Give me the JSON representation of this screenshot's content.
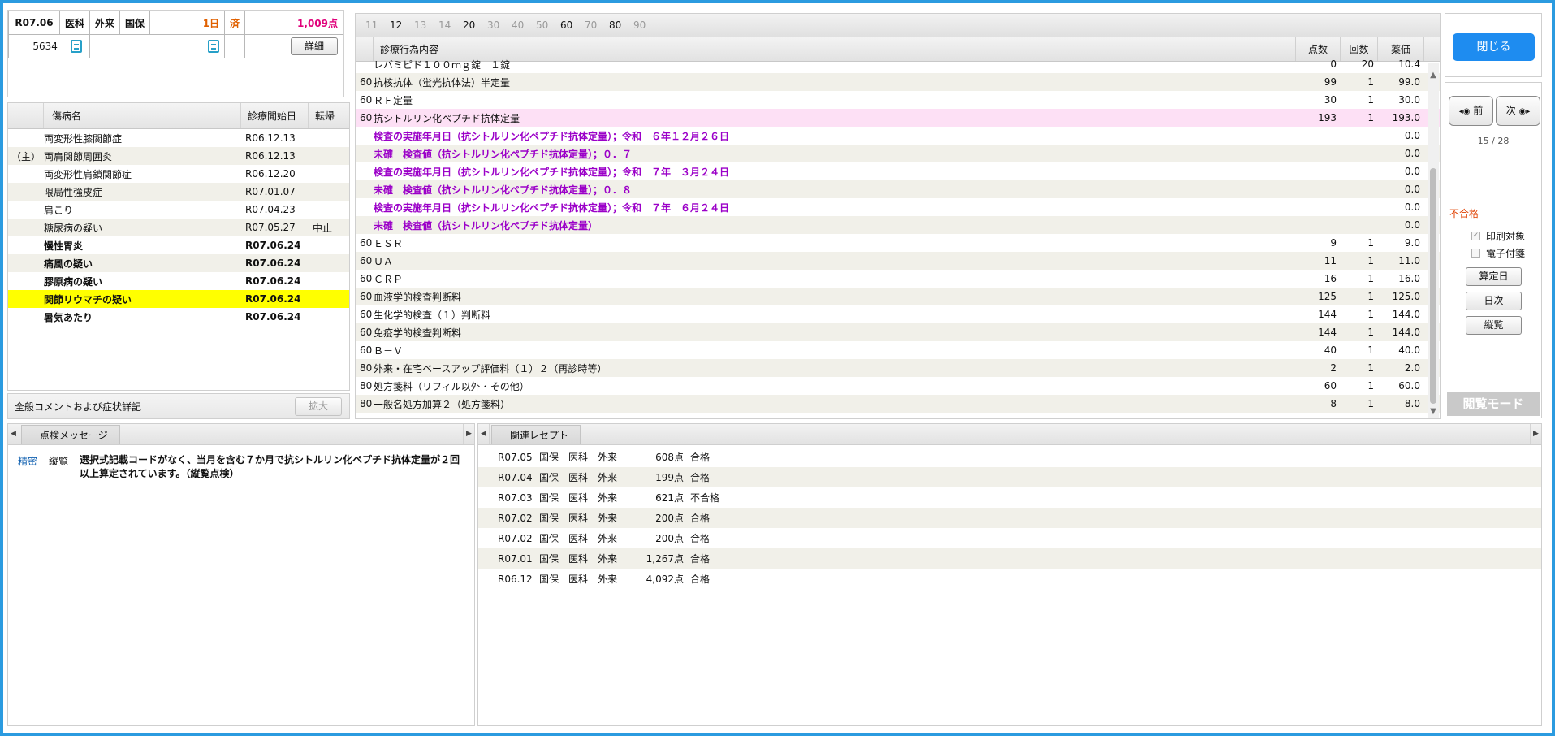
{
  "header": {
    "month": "R07.06",
    "dept": "医科",
    "visit_type": "外来",
    "insurance": "国保",
    "days": "1日",
    "status": "済",
    "total_points": "1,009点",
    "patient_no": "5634",
    "detail_label": "詳細"
  },
  "disease": {
    "headers": [
      "",
      "傷病名",
      "診療開始日",
      "転帰"
    ],
    "rows": [
      {
        "mark": "",
        "name": "両変形性膝関節症",
        "date": "R06.12.13",
        "outcome": "",
        "bold": false,
        "highlight": false
      },
      {
        "mark": "（主）",
        "name": "両肩関節周囲炎",
        "date": "R06.12.13",
        "outcome": "",
        "bold": false,
        "highlight": false
      },
      {
        "mark": "",
        "name": "両変形性肩鎖関節症",
        "date": "R06.12.20",
        "outcome": "",
        "bold": false,
        "highlight": false
      },
      {
        "mark": "",
        "name": "限局性強皮症",
        "date": "R07.01.07",
        "outcome": "",
        "bold": false,
        "highlight": false
      },
      {
        "mark": "",
        "name": "肩こり",
        "date": "R07.04.23",
        "outcome": "",
        "bold": false,
        "highlight": false
      },
      {
        "mark": "",
        "name": "糖尿病の疑い",
        "date": "R07.05.27",
        "outcome": "中止",
        "bold": false,
        "highlight": false
      },
      {
        "mark": "",
        "name": "慢性胃炎",
        "date": "R07.06.24",
        "outcome": "",
        "bold": true,
        "highlight": false
      },
      {
        "mark": "",
        "name": "痛風の疑い",
        "date": "R07.06.24",
        "outcome": "",
        "bold": true,
        "highlight": false
      },
      {
        "mark": "",
        "name": "膠原病の疑い",
        "date": "R07.06.24",
        "outcome": "",
        "bold": true,
        "highlight": false
      },
      {
        "mark": "",
        "name": "関節リウマチの疑い",
        "date": "R07.06.24",
        "outcome": "",
        "bold": true,
        "highlight": true
      },
      {
        "mark": "",
        "name": "暑気あたり",
        "date": "R07.06.24",
        "outcome": "",
        "bold": true,
        "highlight": false
      }
    ]
  },
  "comment": {
    "label": "全般コメントおよび症状詳記",
    "expand_label": "拡大"
  },
  "treatment": {
    "tabs": [
      {
        "label": "11",
        "on": false
      },
      {
        "label": "12",
        "on": true
      },
      {
        "label": "13",
        "on": false
      },
      {
        "label": "14",
        "on": false
      },
      {
        "label": "20",
        "on": true
      },
      {
        "label": "30",
        "on": false
      },
      {
        "label": "40",
        "on": false
      },
      {
        "label": "50",
        "on": false
      },
      {
        "label": "60",
        "on": true
      },
      {
        "label": "70",
        "on": false
      },
      {
        "label": "80",
        "on": true
      },
      {
        "label": "90",
        "on": false
      }
    ],
    "headers": {
      "name": "診療行為内容",
      "points": "点数",
      "count": "回数",
      "price": "薬価"
    },
    "rows": [
      {
        "cat": "",
        "name": "レバミピド１００ｍｇ錠　１錠",
        "points": "0",
        "count": "20",
        "price": "10.4",
        "sub": false,
        "pink": false
      },
      {
        "cat": "60",
        "name": "抗核抗体（蛍光抗体法）半定量",
        "points": "99",
        "count": "1",
        "price": "99.0",
        "sub": false,
        "pink": false
      },
      {
        "cat": "60",
        "name": "ＲＦ定量",
        "points": "30",
        "count": "1",
        "price": "30.0",
        "sub": false,
        "pink": false
      },
      {
        "cat": "60",
        "name": "抗シトルリン化ペプチド抗体定量",
        "points": "193",
        "count": "1",
        "price": "193.0",
        "sub": false,
        "pink": true
      },
      {
        "cat": "",
        "name": "検査の実施年月日（抗シトルリン化ペプチド抗体定量）；令和　６年１２月２６日",
        "points": "",
        "count": "",
        "price": "0.0",
        "sub": true,
        "pink": false
      },
      {
        "cat": "",
        "name": "未確　検査値（抗シトルリン化ペプチド抗体定量）；０．７",
        "points": "",
        "count": "",
        "price": "0.0",
        "sub": true,
        "pink": false
      },
      {
        "cat": "",
        "name": "検査の実施年月日（抗シトルリン化ペプチド抗体定量）；令和　７年　３月２４日",
        "points": "",
        "count": "",
        "price": "0.0",
        "sub": true,
        "pink": false
      },
      {
        "cat": "",
        "name": "未確　検査値（抗シトルリン化ペプチド抗体定量）；０．８",
        "points": "",
        "count": "",
        "price": "0.0",
        "sub": true,
        "pink": false
      },
      {
        "cat": "",
        "name": "検査の実施年月日（抗シトルリン化ペプチド抗体定量）；令和　７年　６月２４日",
        "points": "",
        "count": "",
        "price": "0.0",
        "sub": true,
        "pink": false
      },
      {
        "cat": "",
        "name": "未確　検査値（抗シトルリン化ペプチド抗体定量）",
        "points": "",
        "count": "",
        "price": "0.0",
        "sub": true,
        "pink": false
      },
      {
        "cat": "60",
        "name": "ＥＳＲ",
        "points": "9",
        "count": "1",
        "price": "9.0",
        "sub": false,
        "pink": false
      },
      {
        "cat": "60",
        "name": "ＵＡ",
        "points": "11",
        "count": "1",
        "price": "11.0",
        "sub": false,
        "pink": false
      },
      {
        "cat": "60",
        "name": "ＣＲＰ",
        "points": "16",
        "count": "1",
        "price": "16.0",
        "sub": false,
        "pink": false
      },
      {
        "cat": "60",
        "name": "血液学的検査判断料",
        "points": "125",
        "count": "1",
        "price": "125.0",
        "sub": false,
        "pink": false
      },
      {
        "cat": "60",
        "name": "生化学的検査（１）判断料",
        "points": "144",
        "count": "1",
        "price": "144.0",
        "sub": false,
        "pink": false
      },
      {
        "cat": "60",
        "name": "免疫学的検査判断料",
        "points": "144",
        "count": "1",
        "price": "144.0",
        "sub": false,
        "pink": false
      },
      {
        "cat": "60",
        "name": "Ｂ－Ｖ",
        "points": "40",
        "count": "1",
        "price": "40.0",
        "sub": false,
        "pink": false
      },
      {
        "cat": "80",
        "name": "外来・在宅ベースアップ評価料（１）２（再診時等）",
        "points": "2",
        "count": "1",
        "price": "2.0",
        "sub": false,
        "pink": false
      },
      {
        "cat": "80",
        "name": "処方箋料（リフィル以外・その他）",
        "points": "60",
        "count": "1",
        "price": "60.0",
        "sub": false,
        "pink": false
      },
      {
        "cat": "80",
        "name": "一般名処方加算２（処方箋料）",
        "points": "8",
        "count": "1",
        "price": "8.0",
        "sub": false,
        "pink": false
      }
    ]
  },
  "right": {
    "close_label": "閉じる",
    "prev_label": "前",
    "next_label": "次",
    "counter": "15 / 28",
    "result": "不合格",
    "print_label": "印刷対象",
    "attach_label": "電子付箋",
    "calc_day_label": "算定日",
    "daily_label": "日次",
    "vertical_label": "縦覧",
    "mode_label": "閲覧モード"
  },
  "messages": {
    "tab": "点検メッセージ",
    "rows": [
      {
        "a": "精密",
        "b": "縦覧",
        "text": "選択式記載コードがなく、当月を含む７か月で抗シトルリン化ペプチド抗体定量が２回以上算定されています。（縦覧点検）"
      }
    ]
  },
  "related": {
    "tab": "関連レセプト",
    "rows": [
      {
        "month": "R07.05",
        "ins": "国保",
        "dept": "医科",
        "type": "外来",
        "points": "608点",
        "status": "合格"
      },
      {
        "month": "R07.04",
        "ins": "国保",
        "dept": "医科",
        "type": "外来",
        "points": "199点",
        "status": "合格"
      },
      {
        "month": "R07.03",
        "ins": "国保",
        "dept": "医科",
        "type": "外来",
        "points": "621点",
        "status": "不合格"
      },
      {
        "month": "R07.02",
        "ins": "国保",
        "dept": "医科",
        "type": "外来",
        "points": "200点",
        "status": "合格"
      },
      {
        "month": "R07.02",
        "ins": "国保",
        "dept": "医科",
        "type": "外来",
        "points": "200点",
        "status": "合格"
      },
      {
        "month": "R07.01",
        "ins": "国保",
        "dept": "医科",
        "type": "外来",
        "points": "1,267点",
        "status": "合格"
      },
      {
        "month": "R06.12",
        "ins": "国保",
        "dept": "医科",
        "type": "外来",
        "points": "4,092点",
        "status": "合格"
      }
    ]
  }
}
